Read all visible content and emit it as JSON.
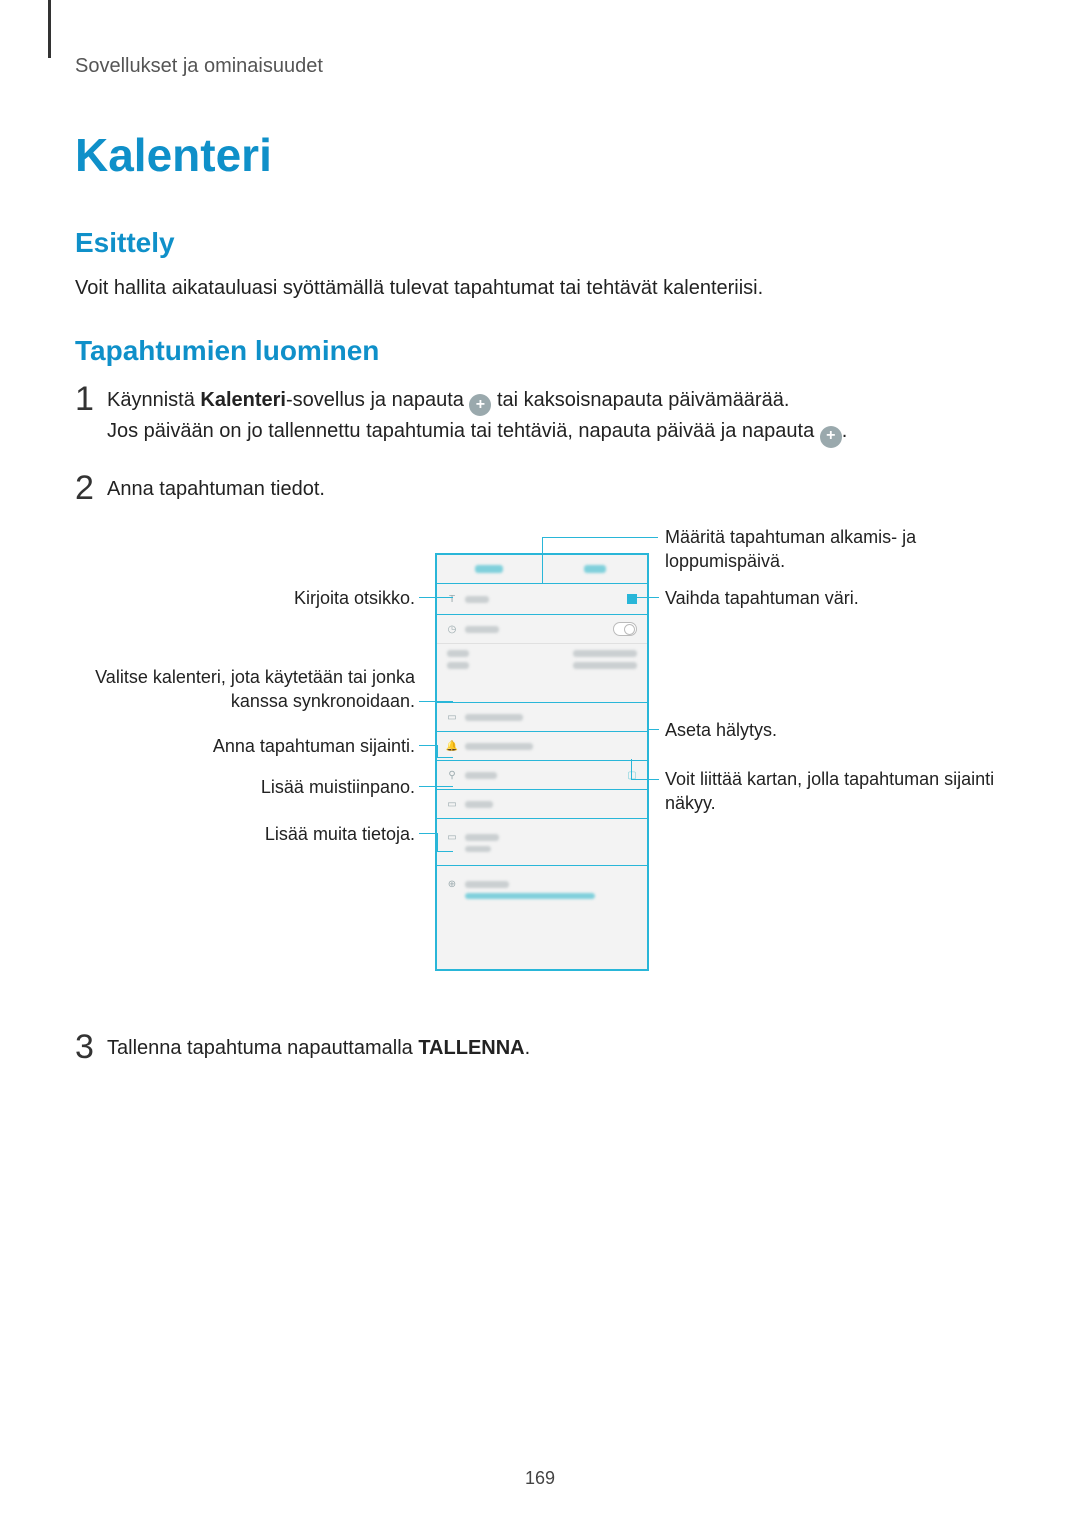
{
  "breadcrumb": "Sovellukset ja ominaisuudet",
  "title": "Kalenteri",
  "section_intro_heading": "Esittely",
  "intro_paragraph": "Voit hallita aikatauluasi syöttämällä tulevat tapahtumat tai tehtävät kalenteriisi.",
  "section_create_heading": "Tapahtumien luominen",
  "steps": {
    "s1": {
      "num": "1",
      "parts": {
        "p1a": "Käynnistä ",
        "p1b_bold": "Kalenteri",
        "p1c": "-sovellus ja napauta ",
        "p1d": " tai kaksoisnapauta päivämäärää.",
        "p2a": "Jos päivään on jo tallennettu tapahtumia tai tehtäviä, napauta päivää ja napauta ",
        "p2b": "."
      }
    },
    "s2": {
      "num": "2",
      "text": "Anna tapahtuman tiedot."
    },
    "s3": {
      "num": "3",
      "p1": "Tallenna tapahtuma napauttamalla ",
      "p2_bold": "TALLENNA",
      "p3": "."
    }
  },
  "callouts": {
    "left": {
      "title": "Kirjoita otsikko.",
      "calendar": "Valitse kalenteri, jota käytetään tai jonka kanssa synkronoidaan.",
      "location": "Anna tapahtuman sijainti.",
      "memo": "Lisää muistiinpano.",
      "more": "Lisää muita tietoja."
    },
    "right": {
      "dates": "Määritä tapahtuman alkamis- ja loppumispäivä.",
      "color": "Vaihda tapahtuman väri.",
      "alarm": "Aseta hälytys.",
      "map": "Voit liittää kartan, jolla tapahtuman sijainti näkyy."
    }
  },
  "plus_glyph": "+",
  "page_number": "169"
}
